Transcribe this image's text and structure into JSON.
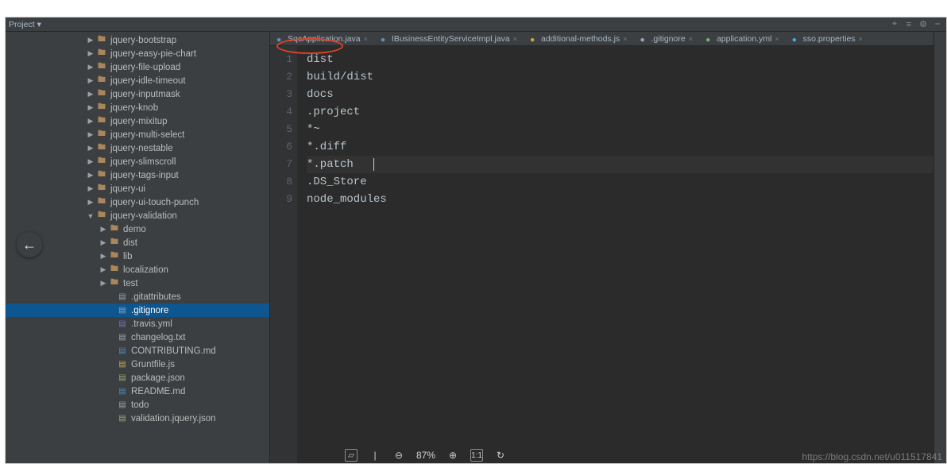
{
  "toolbar": {
    "project_label": "Project ▾"
  },
  "tabs": [
    {
      "label": "SqcApplication.java",
      "icon": "java"
    },
    {
      "label": "IBusinessEntityServiceImpl.java",
      "icon": "java"
    },
    {
      "label": "additional-methods.js",
      "icon": "js"
    },
    {
      "label": ".gitignore",
      "icon": "txt"
    },
    {
      "label": "application.yml",
      "icon": "yml"
    },
    {
      "label": "sso.properties",
      "icon": "prop"
    }
  ],
  "tree": [
    {
      "indent": 96,
      "arrow": "closed",
      "icon": "folder",
      "label": "jquery-bootstrap"
    },
    {
      "indent": 96,
      "arrow": "closed",
      "icon": "folder",
      "label": "jquery-easy-pie-chart"
    },
    {
      "indent": 96,
      "arrow": "closed",
      "icon": "folder",
      "label": "jquery-file-upload"
    },
    {
      "indent": 96,
      "arrow": "closed",
      "icon": "folder",
      "label": "jquery-idle-timeout"
    },
    {
      "indent": 96,
      "arrow": "closed",
      "icon": "folder",
      "label": "jquery-inputmask"
    },
    {
      "indent": 96,
      "arrow": "closed",
      "icon": "folder",
      "label": "jquery-knob"
    },
    {
      "indent": 96,
      "arrow": "closed",
      "icon": "folder",
      "label": "jquery-mixitup"
    },
    {
      "indent": 96,
      "arrow": "closed",
      "icon": "folder",
      "label": "jquery-multi-select"
    },
    {
      "indent": 96,
      "arrow": "closed",
      "icon": "folder",
      "label": "jquery-nestable"
    },
    {
      "indent": 96,
      "arrow": "closed",
      "icon": "folder",
      "label": "jquery-slimscroll"
    },
    {
      "indent": 96,
      "arrow": "closed",
      "icon": "folder",
      "label": "jquery-tags-input"
    },
    {
      "indent": 96,
      "arrow": "closed",
      "icon": "folder",
      "label": "jquery-ui"
    },
    {
      "indent": 96,
      "arrow": "closed",
      "icon": "folder",
      "label": "jquery-ui-touch-punch"
    },
    {
      "indent": 96,
      "arrow": "open",
      "icon": "folder",
      "label": "jquery-validation"
    },
    {
      "indent": 112,
      "arrow": "closed",
      "icon": "folder",
      "label": "demo"
    },
    {
      "indent": 112,
      "arrow": "closed",
      "icon": "folder",
      "label": "dist"
    },
    {
      "indent": 112,
      "arrow": "closed",
      "icon": "folder",
      "label": "lib"
    },
    {
      "indent": 112,
      "arrow": "closed",
      "icon": "folder",
      "label": "localization"
    },
    {
      "indent": 112,
      "arrow": "closed",
      "icon": "folder",
      "label": "test"
    },
    {
      "indent": 122,
      "arrow": "none",
      "icon": "file",
      "label": ".gitattributes"
    },
    {
      "indent": 122,
      "arrow": "none",
      "icon": "file",
      "label": ".gitignore",
      "selected": true
    },
    {
      "indent": 122,
      "arrow": "none",
      "icon": "yml",
      "label": ".travis.yml"
    },
    {
      "indent": 122,
      "arrow": "none",
      "icon": "txt",
      "label": "changelog.txt"
    },
    {
      "indent": 122,
      "arrow": "none",
      "icon": "md",
      "label": "CONTRIBUTING.md"
    },
    {
      "indent": 122,
      "arrow": "none",
      "icon": "js",
      "label": "Gruntfile.js"
    },
    {
      "indent": 122,
      "arrow": "none",
      "icon": "json",
      "label": "package.json"
    },
    {
      "indent": 122,
      "arrow": "none",
      "icon": "md",
      "label": "README.md"
    },
    {
      "indent": 122,
      "arrow": "none",
      "icon": "txt",
      "label": "todo"
    },
    {
      "indent": 122,
      "arrow": "none",
      "icon": "json",
      "label": "validation.jquery.json"
    }
  ],
  "code": {
    "lines": [
      "dist",
      "build/dist",
      "docs",
      ".project",
      "*~",
      "*.diff",
      "*.patch",
      ".DS_Store",
      "node_modules"
    ],
    "current_line_index": 6
  },
  "viewer": {
    "zoom": "87%",
    "one_to_one": "1:1"
  },
  "watermark": "https://blog.csdn.net/u011517841"
}
